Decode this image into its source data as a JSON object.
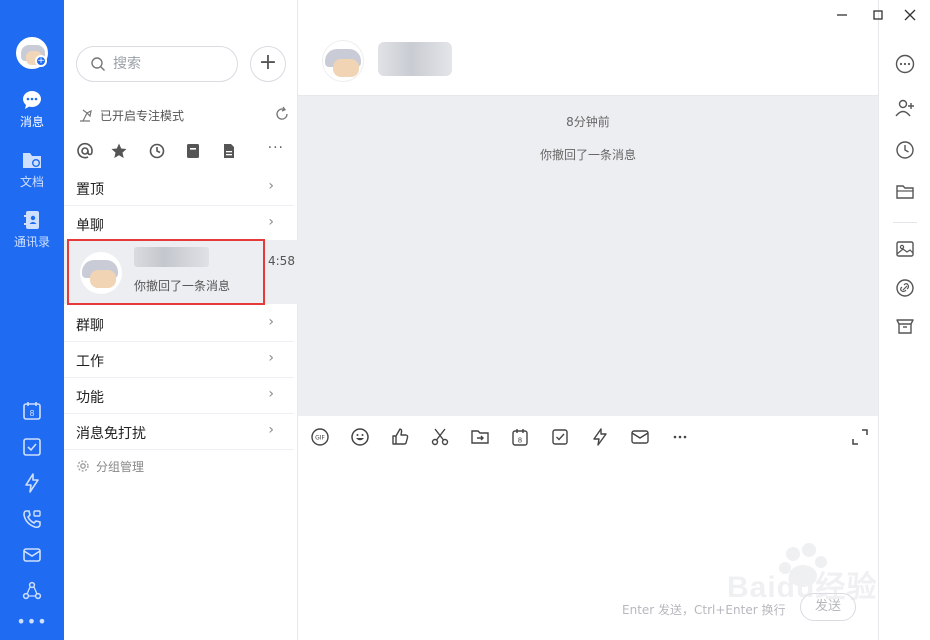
{
  "nav": {
    "items": [
      {
        "label": "消息",
        "icon": "chat-bubble-icon",
        "active": true
      },
      {
        "label": "文档",
        "icon": "document-folder-icon",
        "active": false
      },
      {
        "label": "通讯录",
        "icon": "contacts-book-icon",
        "active": false
      }
    ],
    "bottom_icons": [
      "calendar-icon",
      "checkbox-icon",
      "lightning-icon",
      "phone-icon",
      "mail-icon",
      "network-icon",
      "more-dots-icon"
    ],
    "calendar_day": "8"
  },
  "list": {
    "search_placeholder": "搜索",
    "add_label": "+",
    "focus_mode_text": "已开启专注模式",
    "filter_more": "···",
    "groups": [
      {
        "label": "置顶"
      },
      {
        "label": "单聊"
      },
      {
        "label": "群聊"
      },
      {
        "label": "工作"
      },
      {
        "label": "功能"
      },
      {
        "label": "消息免打扰"
      }
    ],
    "chevron": "›",
    "conversation": {
      "time": "4:58",
      "preview": "你撤回了一条消息"
    },
    "manage_label": "分组管理"
  },
  "chat": {
    "timestamp": "8分钟前",
    "recall_notice": "你撤回了一条消息",
    "composer_hint": "Enter 发送，Ctrl+Enter 换行",
    "send_label": "发送",
    "toolbar_gif": "GIF",
    "toolbar_calendar_day": "8"
  },
  "watermark": {
    "text": "Baidu经验"
  },
  "colors": {
    "nav_bg": "#1f6bf2",
    "chat_bg": "#edeef1",
    "highlight_border": "#e63a3a"
  }
}
